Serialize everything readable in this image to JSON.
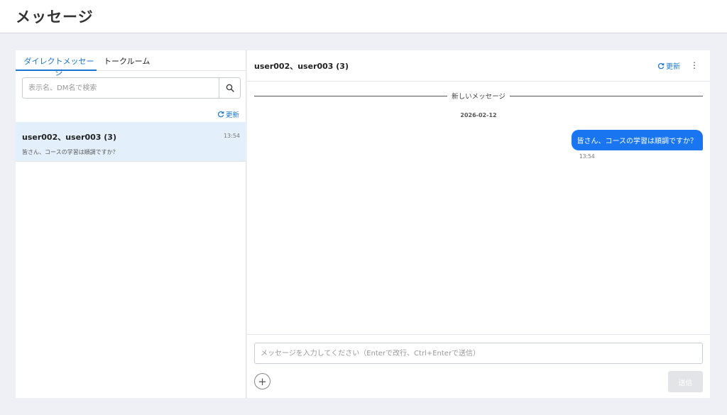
{
  "header": {
    "title": "メッセージ"
  },
  "sidebar": {
    "tabs": [
      {
        "label": "ダイレクトメッセージ",
        "active": true
      },
      {
        "label": "トークルーム",
        "active": false
      }
    ],
    "search": {
      "placeholder": "表示名、DM名で検索",
      "value": ""
    },
    "refresh_label": "更新",
    "conversations": [
      {
        "name": "user002、user003 (3)",
        "time": "13:54",
        "preview": "皆さん、コースの学習は順調ですか？",
        "selected": true
      }
    ]
  },
  "chat": {
    "title": "user002、user003 (3)",
    "refresh_label": "更新",
    "more_icon": "more-vert-icon",
    "divider_label": "新しいメッセージ",
    "date_label": "2026-02-12",
    "messages": [
      {
        "text": "皆さん、コースの学習は順調ですか？",
        "time": "13:54",
        "own": true
      }
    ],
    "composer": {
      "placeholder": "メッセージを入力してください（Enterで改行、Ctrl+Enterで送信）",
      "value": "",
      "send_label": "送信",
      "send_enabled": false
    }
  },
  "colors": {
    "accent": "#1976d2",
    "bubble": "#1976f0",
    "selected_row": "#e3f0fc",
    "background": "#eef0f5"
  }
}
